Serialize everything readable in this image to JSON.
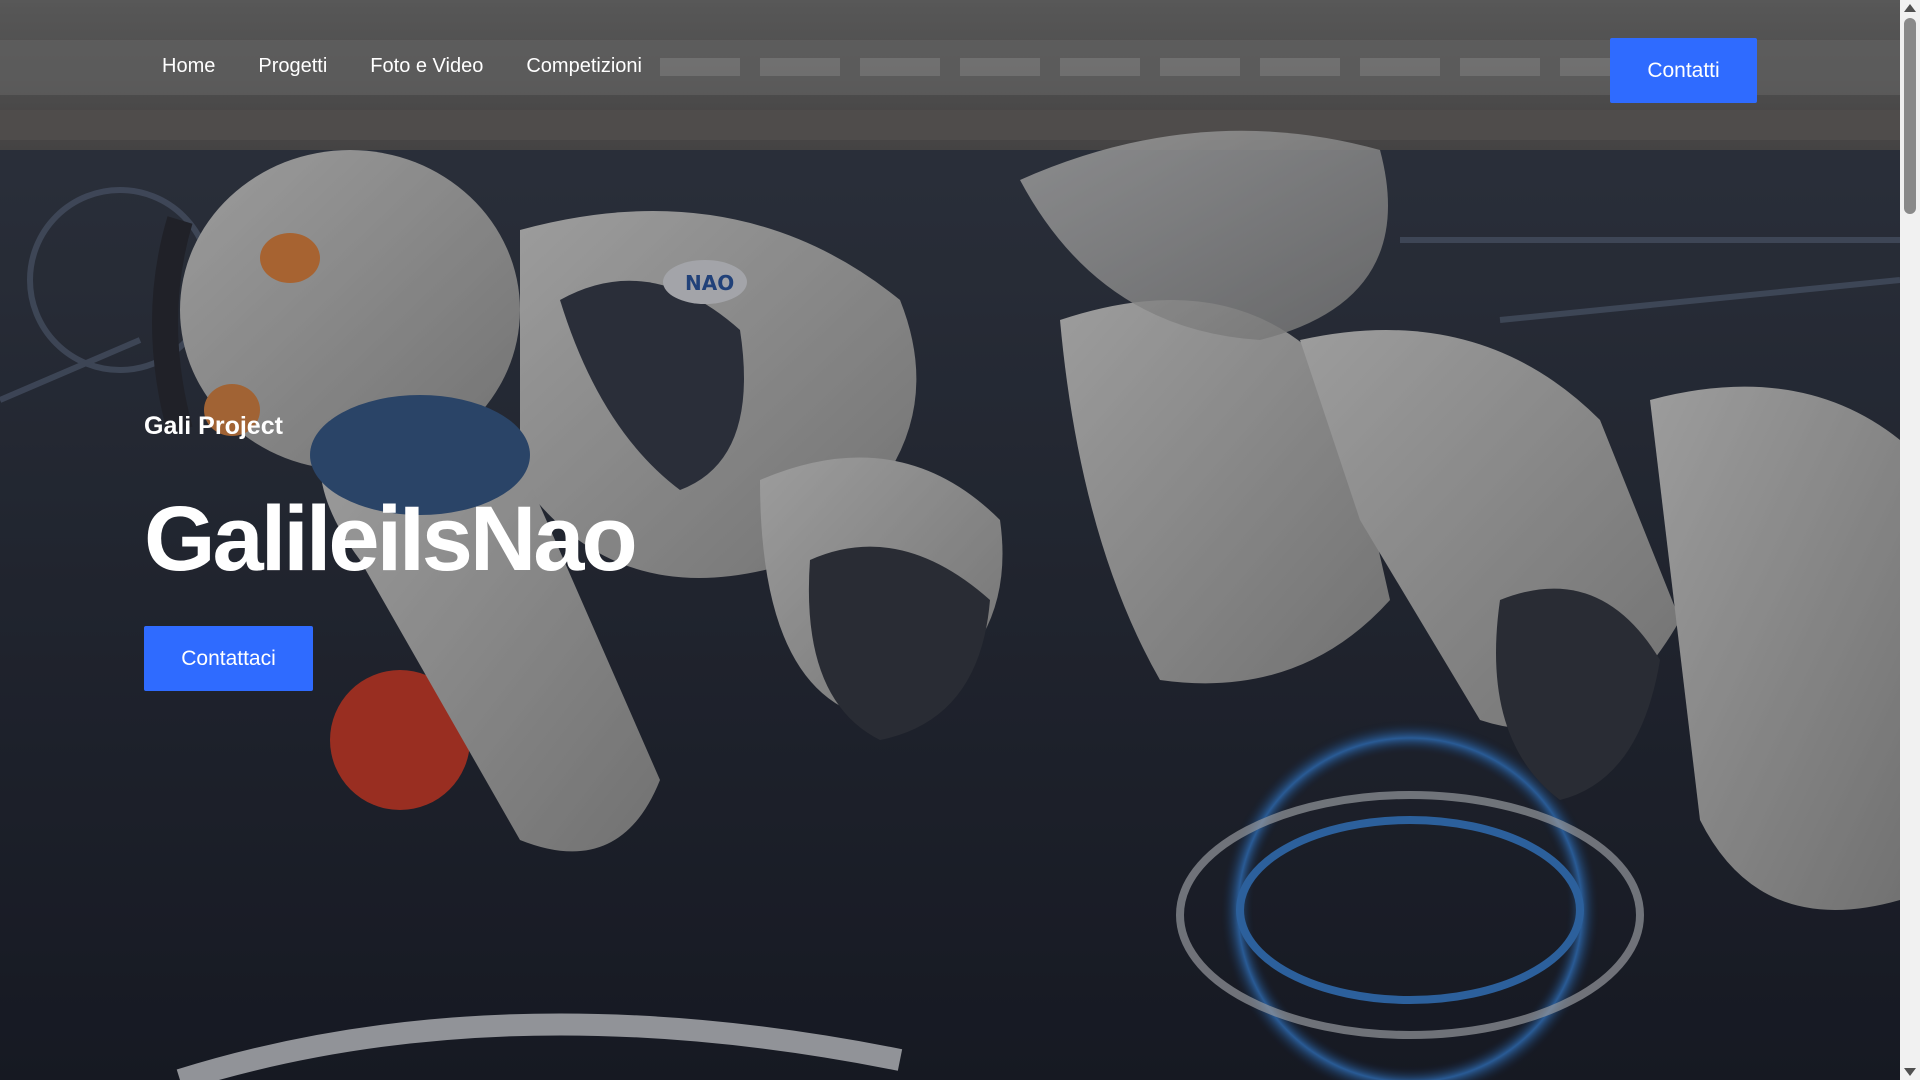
{
  "nav": {
    "links": [
      "Home",
      "Progetti",
      "Foto e Video",
      "Competizioni"
    ],
    "contact_label": "Contatti"
  },
  "hero": {
    "eyebrow": "Gali Project",
    "title": "GalileiIsNao",
    "cta_label": "Contattaci",
    "robot_badge": "NAO"
  },
  "colors": {
    "accent": "#2f6bff",
    "text": "#ffffff"
  }
}
